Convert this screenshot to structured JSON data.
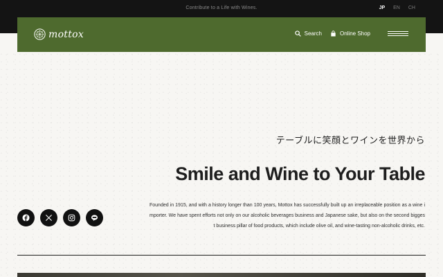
{
  "topbar": {
    "tagline": "Contribute to a Life with Wines.",
    "languages": [
      "JP",
      "EN",
      "CH"
    ],
    "active_language": "JP"
  },
  "nav": {
    "logo_text": "mottox",
    "search_label": "Search",
    "shop_label": "Online Shop",
    "search_icon": "search-icon",
    "shop_icon": "shopping-bag-icon",
    "menu_icon": "hamburger-menu-icon",
    "background_color": "#4e6a2e"
  },
  "hero": {
    "jp_subtitle": "テーブルに笑顔とワインを世界から",
    "title": "Smile and Wine to Your Table",
    "body": "Founded in 1915, and with a history longer than 100 years, Mottox has successfully built up an irreplaceable position as a wine importer. We have spent efforts not only on our alcoholic beverages business and Japanese sake, but also on the second biggest business pillar of food products, which include olive oil, and wine-tasting non-alcoholic drinks, etc."
  },
  "socials": [
    {
      "name": "facebook",
      "icon": "facebook-icon"
    },
    {
      "name": "x",
      "icon": "x-icon"
    },
    {
      "name": "instagram",
      "icon": "instagram-icon"
    },
    {
      "name": "line",
      "icon": "line-icon"
    }
  ]
}
